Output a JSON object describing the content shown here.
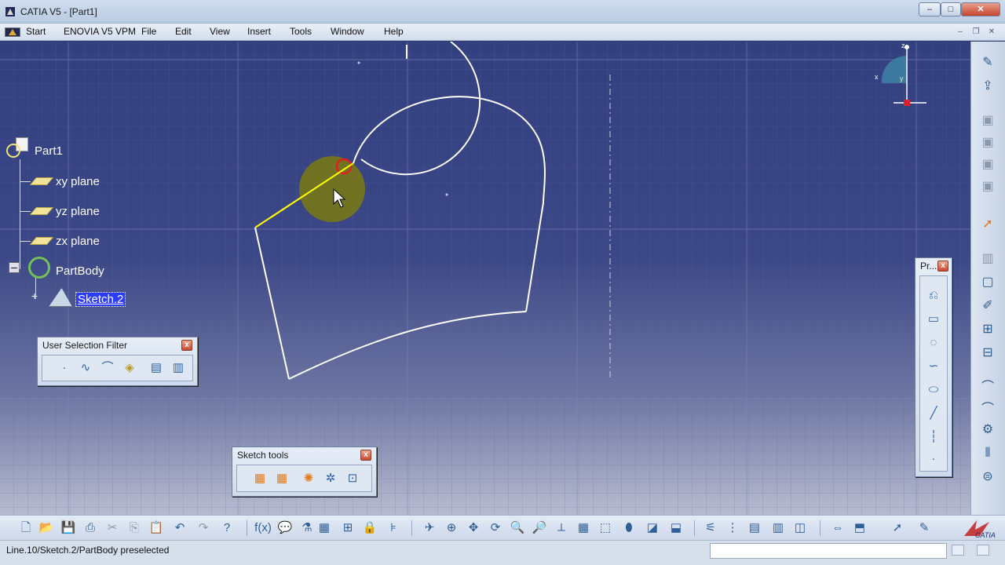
{
  "window": {
    "title": "CATIA V5 - [Part1]",
    "minimize": "–",
    "maximize": "□",
    "close": "✕"
  },
  "menubar": {
    "items": [
      "Start",
      "ENOVIA V5 VPM",
      "File",
      "Edit",
      "View",
      "Insert",
      "Tools",
      "Window",
      "Help"
    ],
    "mdi_minimize": "–",
    "mdi_restore": "❐",
    "mdi_close": "✕"
  },
  "tree": {
    "root": "Part1",
    "planes": [
      "xy plane",
      "yz plane",
      "zx plane"
    ],
    "body": "PartBody",
    "sketch": "Sketch.2"
  },
  "compass": {
    "x": "x",
    "y": "y",
    "z": "z"
  },
  "user_selection_filter": {
    "title": "User Selection Filter",
    "close": "x",
    "icons": [
      "point-filter-icon",
      "curve-filter-icon",
      "surface-filter-icon",
      "volume-filter-icon",
      "feature-element-filter-icon",
      "geometrical-element-filter-icon"
    ]
  },
  "sketch_tools": {
    "title": "Sketch tools",
    "close": "x",
    "icons": [
      "grid-icon",
      "snap-to-point-icon",
      "construction-element-icon",
      "geometrical-constraints-icon",
      "dimensional-constraints-icon"
    ]
  },
  "profile_toolbar": {
    "title": "Pr...",
    "close": "x",
    "icons": [
      "profile-icon",
      "rectangle-icon",
      "circle-icon",
      "spline-icon",
      "ellipse-icon",
      "line-icon",
      "axis-icon",
      "point-icon"
    ]
  },
  "statusbar": {
    "text": "Line.10/Sketch.2/PartBody preselected",
    "input_value": ""
  },
  "colors": {
    "viewport_top": "#334080",
    "sketch_line": "#ffffff",
    "preselect_line": "#ffff00",
    "selected_tree_item": "#2c3cff"
  }
}
